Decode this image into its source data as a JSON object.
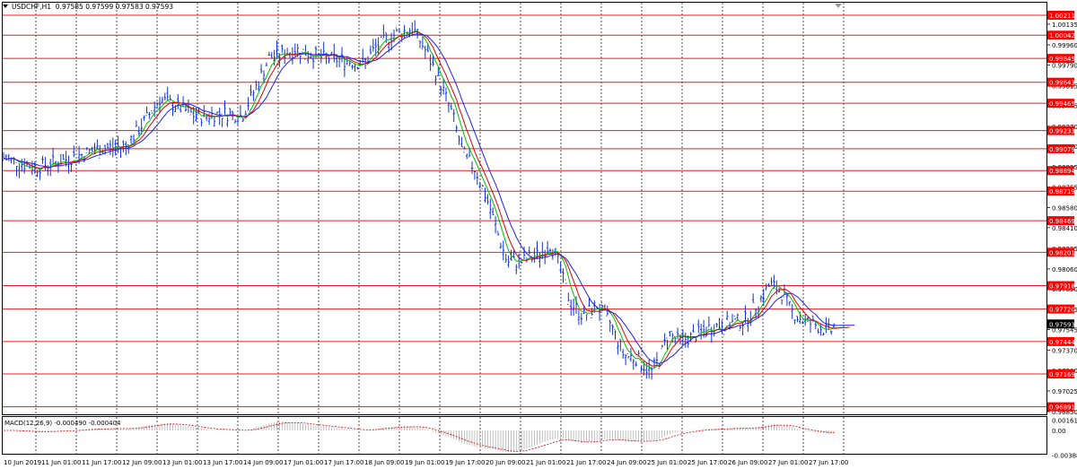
{
  "header": {
    "symbol": "USDCHF,H1",
    "prices": "0.97585 0.97599 0.97583 0.97593"
  },
  "macd": {
    "label": "MACD(12,26,9) -0.000490 -0.000404",
    "ticks": [
      "0.001615",
      "0.00",
      "-0.003887"
    ]
  },
  "colors": {
    "price_bars": "#0f34d6",
    "level_lines": "#e02020",
    "level_box": "#ff0000",
    "current_box": "#000000",
    "ma_green": "#00c000",
    "ma_red": "#e00000",
    "ma_blue": "#2020f0",
    "grid": "#222222",
    "macd_signal": "#e00000",
    "macd_hist": "#b0b0b0"
  },
  "icons": [
    "dropdown-arrow-icon",
    "scroll-marker-icon"
  ],
  "price_axis": {
    "ticks": [
      "1.00135",
      "0.99960",
      "0.99790",
      "0.99615",
      "0.99445",
      "0.99270",
      "0.99100",
      "0.98925",
      "0.98755",
      "0.98580",
      "0.98410",
      "0.98235",
      "0.98060",
      "0.97890",
      "0.97715",
      "0.97545",
      "0.97370",
      "0.97200",
      "0.97025",
      "0.96850"
    ]
  },
  "levels": [
    "1.00211",
    "1.00042",
    "0.99845",
    "0.99643",
    "0.99465",
    "0.99233",
    "0.99079",
    "0.98894",
    "0.98719",
    "0.98469",
    "0.98201",
    "0.97918",
    "0.97720",
    "0.97444",
    "0.97169",
    "0.96891"
  ],
  "current_price": "0.97593",
  "time_axis": {
    "labels": [
      "10 Jun 2019",
      "11 Jun 01:00",
      "11 Jun 17:00",
      "12 Jun 09:00",
      "13 Jun 01:00",
      "13 Jun 17:00",
      "14 Jun 09:00",
      "17 Jun 01:00",
      "17 Jun 17:00",
      "18 Jun 09:00",
      "19 Jun 01:00",
      "19 Jun 17:00",
      "20 Jun 09:00",
      "21 Jun 01:00",
      "21 Jun 17:00",
      "24 Jun 09:00",
      "25 Jun 01:00",
      "25 Jun 17:00",
      "26 Jun 09:00",
      "27 Jun 01:00",
      "27 Jun 17:00"
    ]
  }
}
